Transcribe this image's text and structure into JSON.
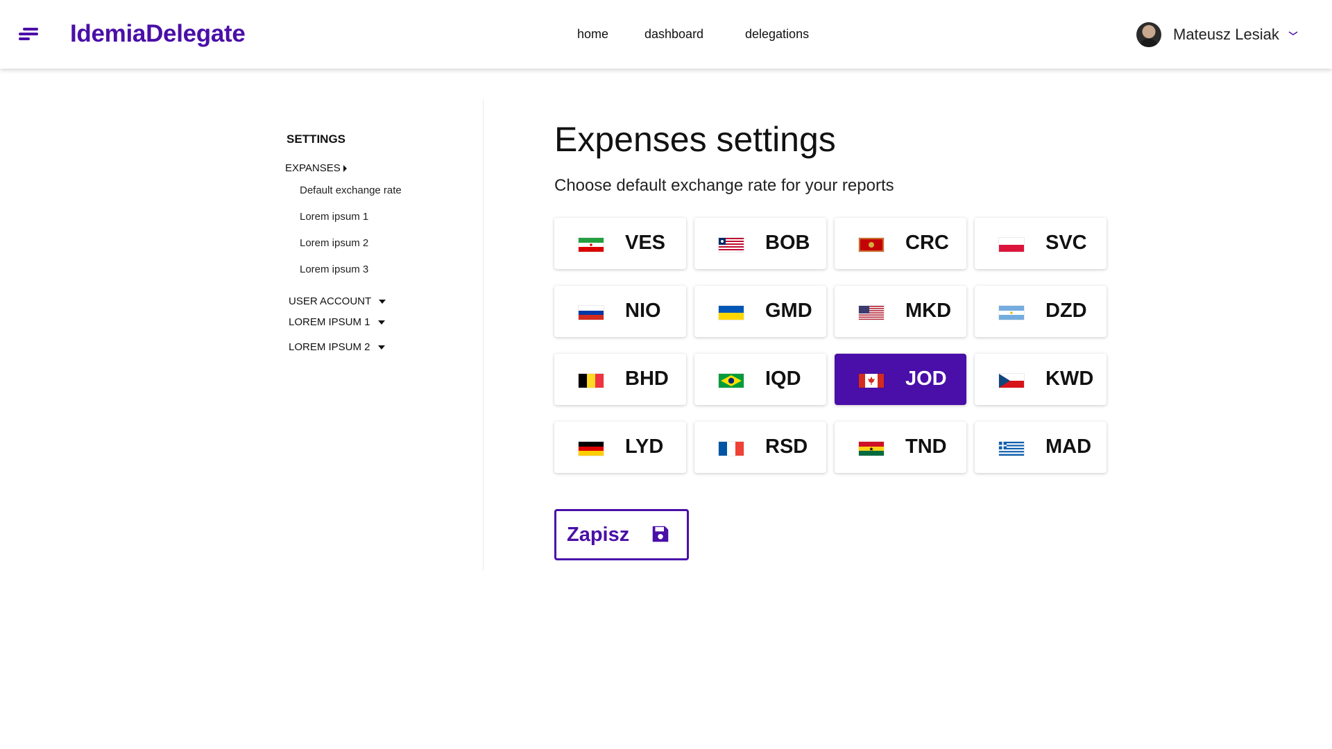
{
  "brand": {
    "name": "IdemiaDelegate"
  },
  "nav": {
    "home": "home",
    "dashboard": "dashboard",
    "delegations": "delegations"
  },
  "user": {
    "name": "Mateusz Lesiak"
  },
  "sidebar": {
    "title": "SETTINGS",
    "expanses": {
      "label": "EXPANSES",
      "items": [
        "Default exchange rate",
        "Lorem ipsum 1",
        "Lorem ipsum 2",
        "Lorem ipsum 3"
      ]
    },
    "sections": [
      "USER ACCOUNT",
      "LOREM IPSUM 1",
      "LOREM IPSUM 2"
    ]
  },
  "main": {
    "title": "Expenses settings",
    "subtitle": "Choose default exchange rate for your reports"
  },
  "currencies": [
    {
      "code": "VES",
      "flag": "iran-flag-icon"
    },
    {
      "code": "BOB",
      "flag": "liberia-flag-icon"
    },
    {
      "code": "CRC",
      "flag": "montenegro-flag-icon"
    },
    {
      "code": "SVC",
      "flag": "poland-flag-icon"
    },
    {
      "code": "NIO",
      "flag": "russia-flag-icon"
    },
    {
      "code": "GMD",
      "flag": "ukraine-flag-icon"
    },
    {
      "code": "MKD",
      "flag": "usa-flag-icon"
    },
    {
      "code": "DZD",
      "flag": "argentina-flag-icon"
    },
    {
      "code": "BHD",
      "flag": "belgium-flag-icon"
    },
    {
      "code": "IQD",
      "flag": "brazil-flag-icon"
    },
    {
      "code": "JOD",
      "flag": "canada-flag-icon",
      "selected": true
    },
    {
      "code": "KWD",
      "flag": "czech-flag-icon"
    },
    {
      "code": "LYD",
      "flag": "germany-flag-icon"
    },
    {
      "code": "RSD",
      "flag": "france-flag-icon"
    },
    {
      "code": "TND",
      "flag": "ghana-flag-icon"
    },
    {
      "code": "MAD",
      "flag": "greece-flag-icon"
    }
  ],
  "actions": {
    "save_label": "Zapisz"
  },
  "colors": {
    "accent": "#4a0fa8",
    "selected_text": "#ffffff"
  }
}
